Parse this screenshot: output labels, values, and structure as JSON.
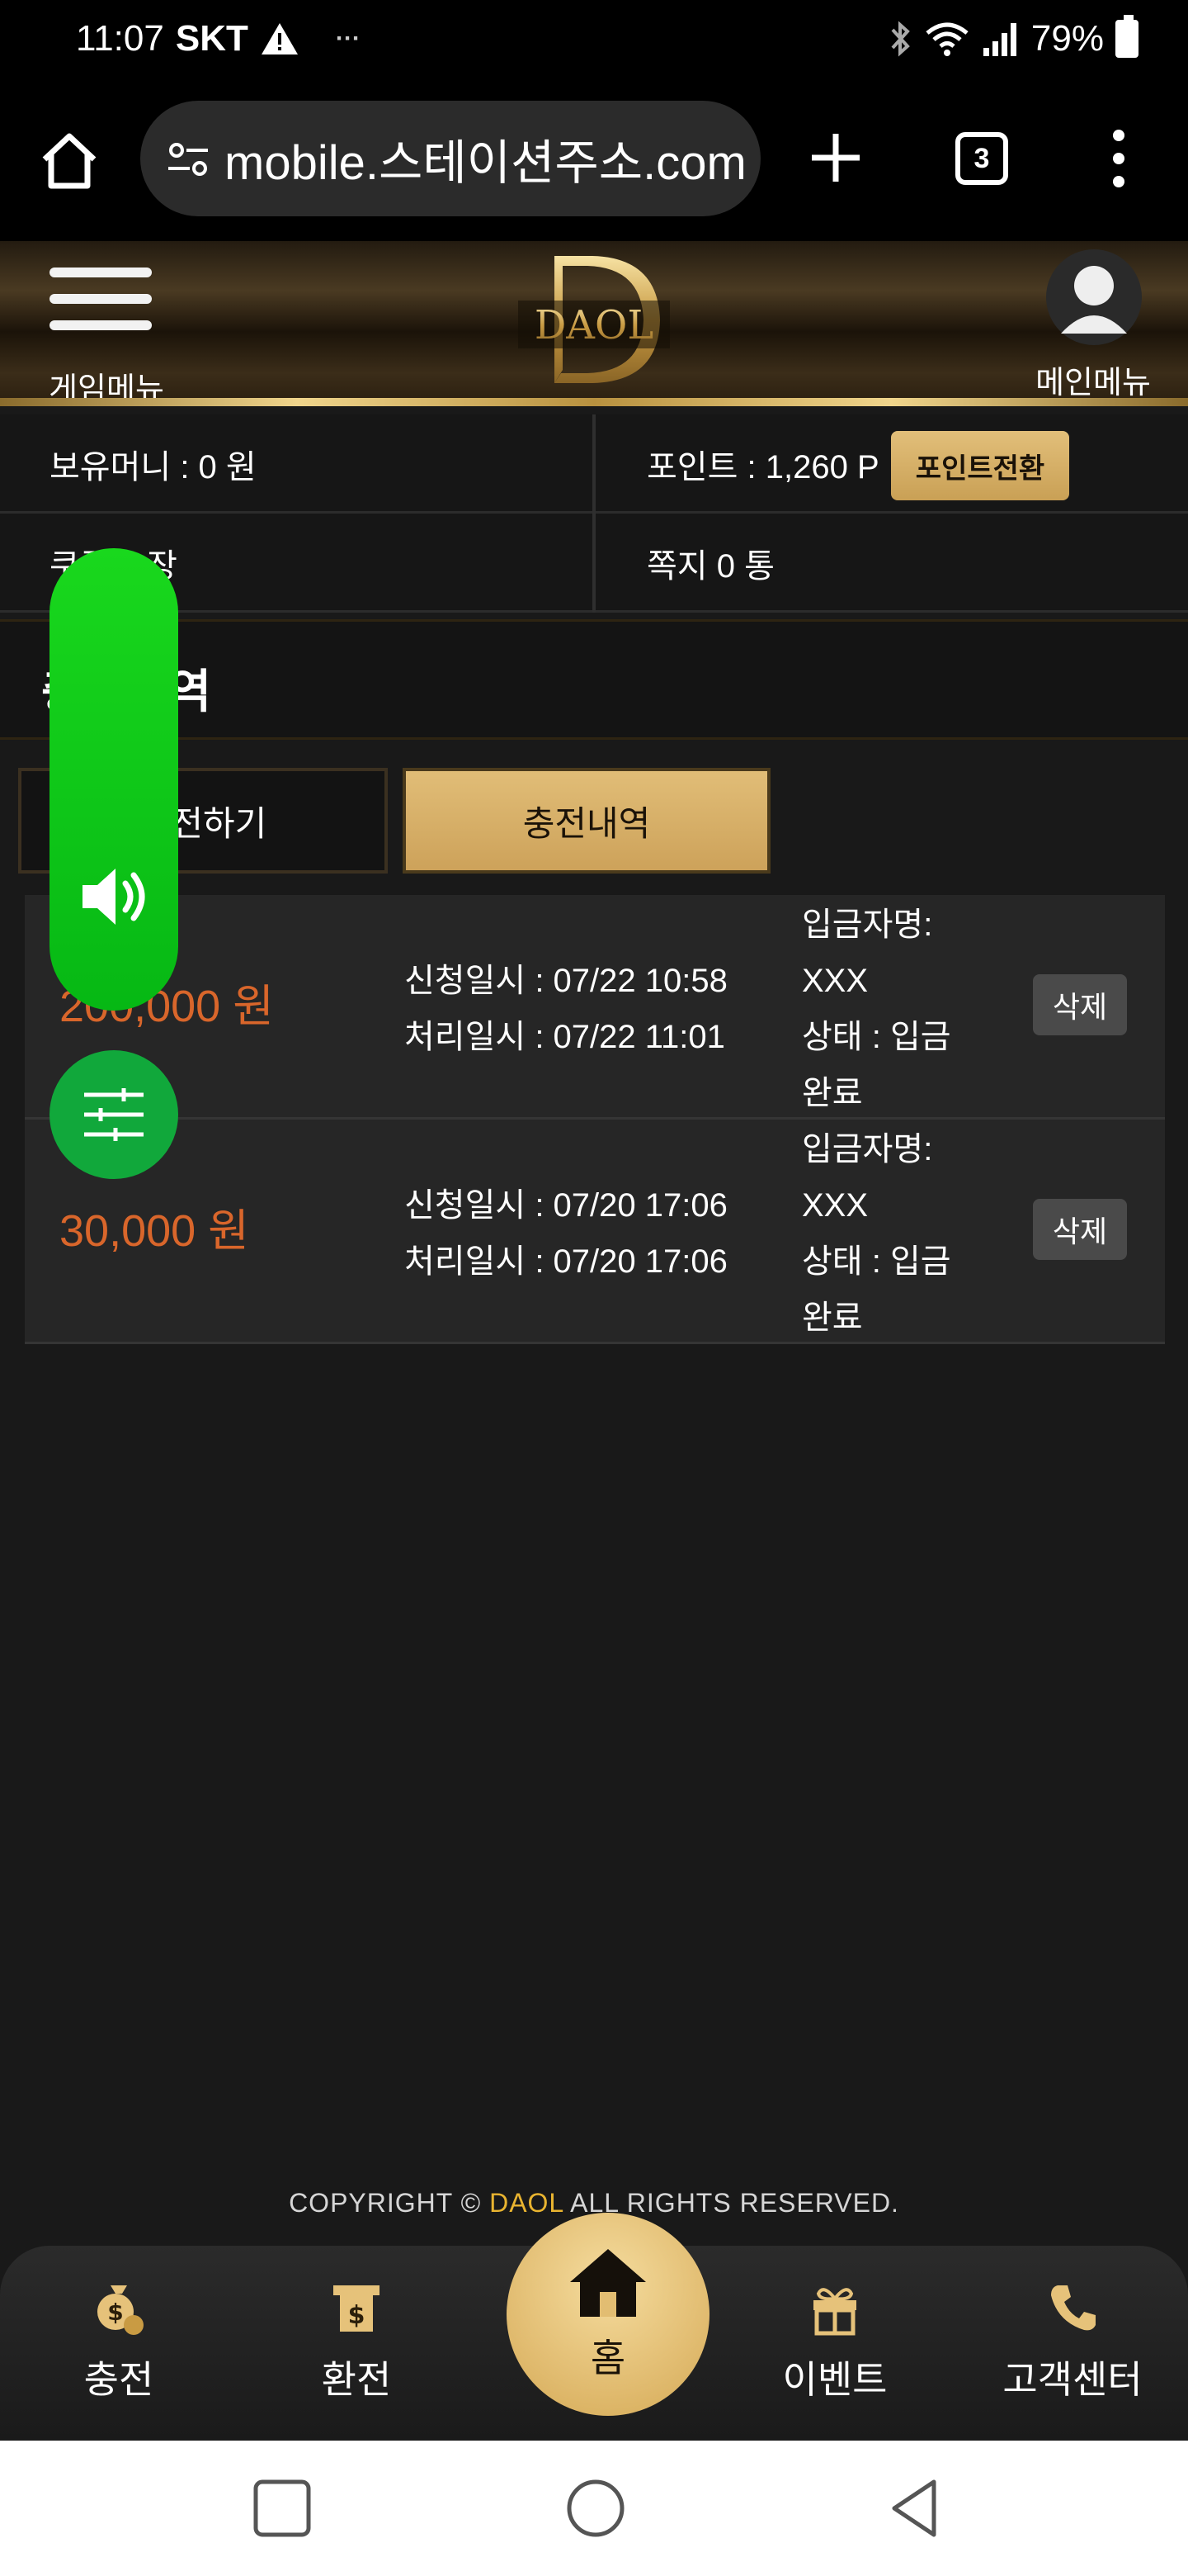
{
  "status_bar": {
    "time": "11:07",
    "carrier": "SKT",
    "dots": "···",
    "battery": "79%"
  },
  "browser": {
    "url": "mobile.스테이션주소.com",
    "tab_count": "3"
  },
  "header": {
    "game_menu_label": "게임메뉴",
    "logo_text": "DAOL",
    "main_menu_label": "메인메뉴"
  },
  "info": {
    "money": "보유머니 : 0 원",
    "points": "포인트 : 1,260 P",
    "point_convert": "포인트전환",
    "coupons": "쿠폰 0 장",
    "messages": "쪽지 0 통"
  },
  "section_title": "충전내역",
  "tabs": {
    "apply": "충전하기",
    "history": "충전내역"
  },
  "history": [
    {
      "amount": "200,000 원",
      "requested": "신청일시 : 07/22 10:58",
      "processed": "처리일시 : 07/22 11:01",
      "depositor_label": "입금자명:",
      "depositor": "XXX",
      "status": "상태 : 입금",
      "status_cont": "완료",
      "delete": "삭제"
    },
    {
      "amount": "30,000 원",
      "requested": "신청일시 : 07/20 17:06",
      "processed": "처리일시 : 07/20 17:06",
      "depositor_label": "입금자명:",
      "depositor": "XXX",
      "status": "상태 : 입금",
      "status_cont": "완료",
      "delete": "삭제"
    }
  ],
  "copyright": {
    "prefix": "COPYRIGHT © ",
    "brand": "DAOL",
    "suffix": " ALL RIGHTS RESERVED."
  },
  "bottom_nav": {
    "charge": "충전",
    "exchange": "환전",
    "home": "홈",
    "event": "이벤트",
    "support": "고객센터"
  },
  "colors": {
    "gold": "#d9b46c",
    "amount_orange": "#d9662b",
    "float_green": "#11c21d"
  }
}
